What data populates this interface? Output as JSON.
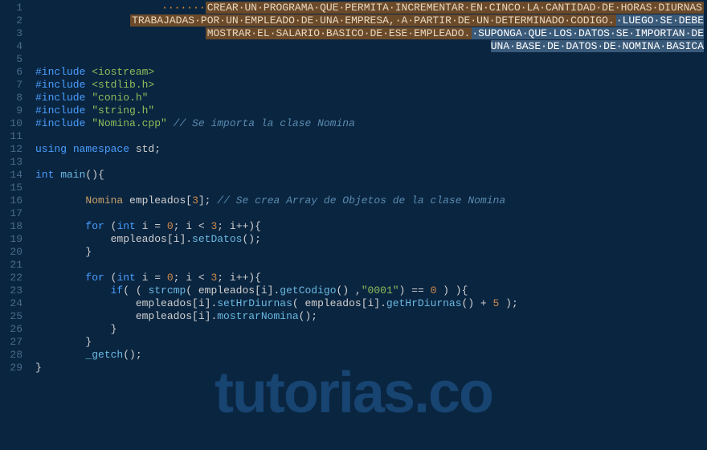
{
  "watermark": "tutorias.co",
  "lineCount": 29,
  "code": {
    "comment1": "CREAR·UN·PROGRAMA·QUE·PERMITA·INCREMENTAR·EN·CINCO·LA·CANTIDAD·DE·HORAS·DIURNAS",
    "comment2": "TRABAJADAS·POR·UN·EMPLEADO·DE·UNA·EMPRESA,·A·PARTIR·DE·UN·DETERMINADO·CODIGO.",
    "comment2b": "·LUEGO·SE·DEBE",
    "comment3": "MOSTRAR·EL·SALARIO·BASICO·DE·ESE·EMPLEADO.",
    "comment3b": "·SUPONGA·QUE·LOS·DATOS·SE·IMPORTAN·DE",
    "comment4": "UNA·BASE·DE·DATOS·DE·NOMINA·BASICA",
    "include": "#include ",
    "inc1": "<iostream>",
    "inc2": "<stdlib.h>",
    "inc3": "\"conio.h\"",
    "inc4": "\"string.h\"",
    "inc5": "\"Nomina.cpp\"",
    "cmtImport": " // Se importa la clase Nomina",
    "using": "using",
    "namespace": " namespace",
    "std": " std;",
    "intKw": "int",
    "mainFn": " main",
    "parenOpen": "(){",
    "nominaType": "Nomina",
    "empDecl": " empleados[",
    "three": "3",
    "declEnd": "]; ",
    "cmtArray": "// Se crea Array de Objetos de la clase Nomina",
    "forKw": "for",
    "forOpen": " (",
    "intI": "int",
    "iEq": " i = ",
    "zero": "0",
    "iLt": "; i < ",
    "iInc": "; i++){",
    "empIdx": "empleados[i].",
    "setDatos": "setDatos",
    "callEnd": "();",
    "braceClose": "}",
    "ifKw": "if",
    "ifOpen": "( ( ",
    "strcmpFn": "strcmp",
    "strcmpArg1": "( empleados[i].",
    "getCodigo": "getCodigo",
    "strcmpMid": "() ,",
    "codeStr": "\"0001\"",
    "strcmpEnd": ") == ",
    "strcmpClose": " ) ){",
    "setHr": "setHrDiurnas",
    "setHrArg": "( empleados[i].",
    "getHr": "getHrDiurnas",
    "plus5a": "() + ",
    "five": "5",
    "plus5b": " );",
    "mostrar": "mostrarNomina",
    "getch": "_getch",
    "indent1": "        ",
    "indent2": "            ",
    "indent3": "                ",
    "indentDot": "·······"
  }
}
